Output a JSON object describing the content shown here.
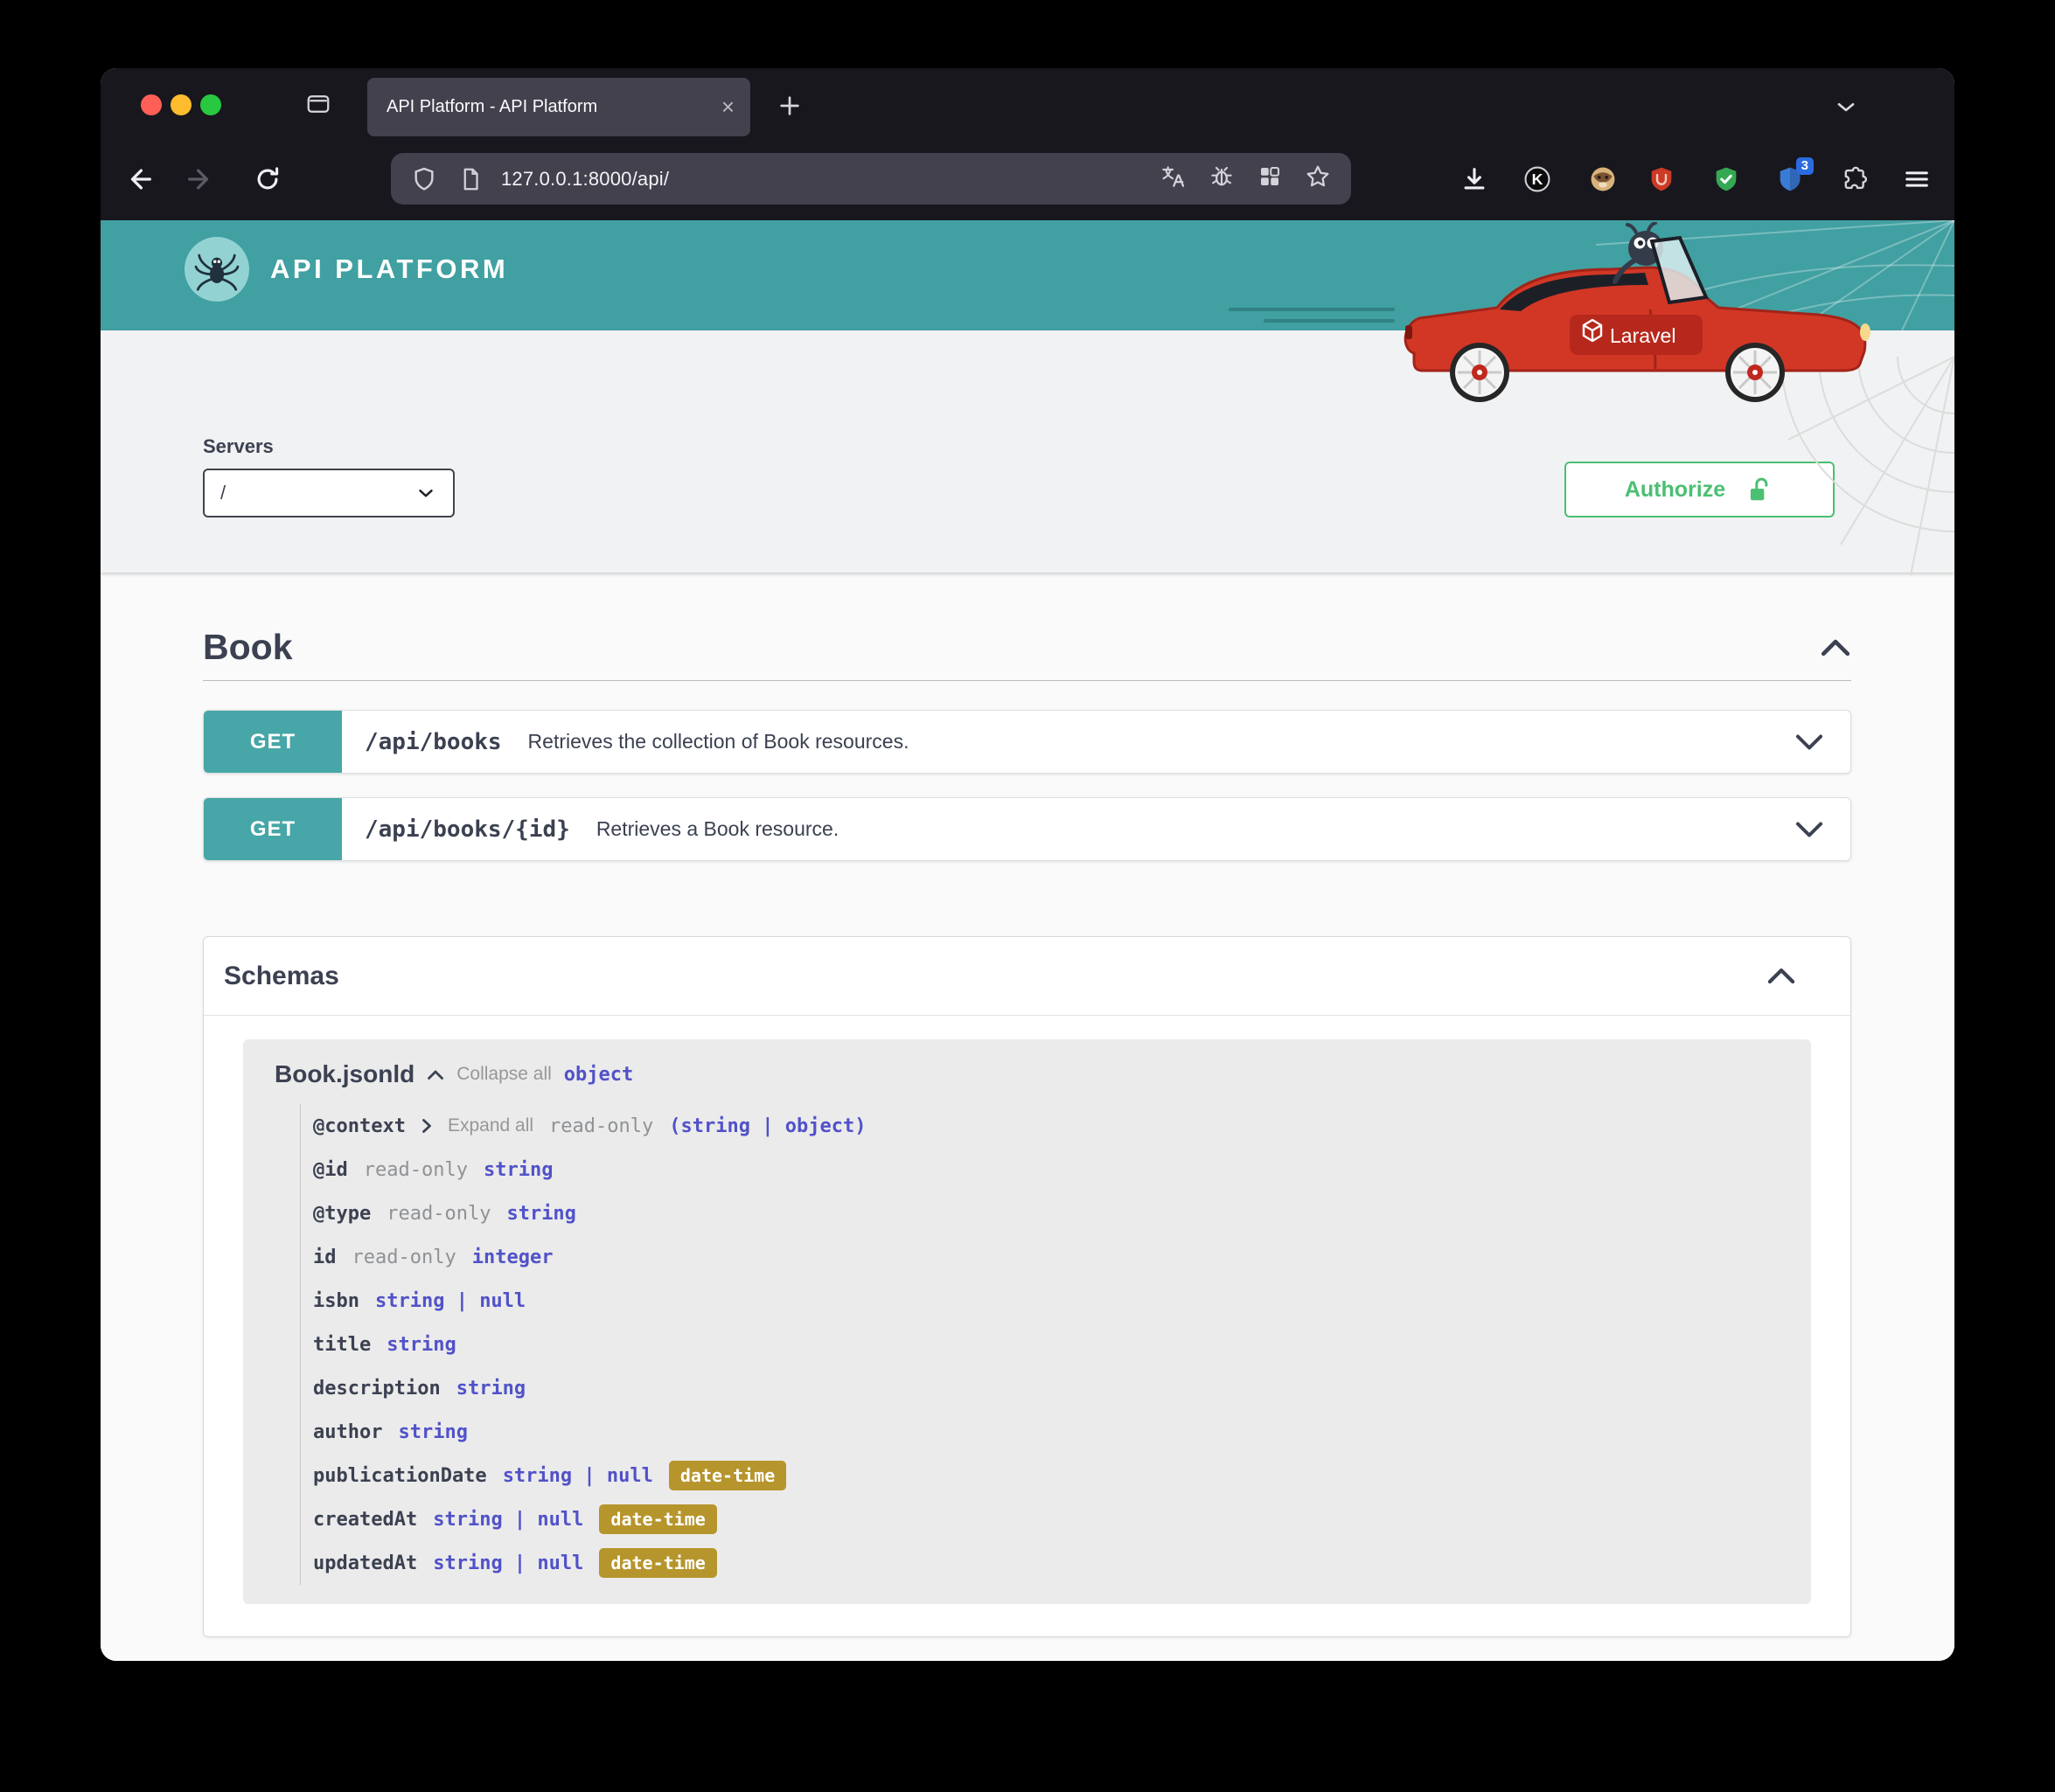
{
  "browser": {
    "tab_title": "API Platform - API Platform",
    "url": "127.0.0.1:8000/api/",
    "extension_badge": "3",
    "k_extension_label": "K"
  },
  "header": {
    "brand": "API PLATFORM",
    "car_badge": "Laravel"
  },
  "servers": {
    "label": "Servers",
    "selected": "/"
  },
  "auth": {
    "authorize_label": "Authorize"
  },
  "tag_section": {
    "title": "Book"
  },
  "operations": [
    {
      "method": "GET",
      "path": "/api/books",
      "description": "Retrieves the collection of Book resources."
    },
    {
      "method": "GET",
      "path": "/api/books/{id}",
      "description": "Retrieves a Book resource."
    }
  ],
  "schemas": {
    "title": "Schemas",
    "model": {
      "name": "Book.jsonld",
      "collapse_all": "Collapse all",
      "expand_all": "Expand all",
      "type": "object",
      "properties": [
        {
          "name": "@context",
          "readonly": "read-only",
          "type": "(string | object)"
        },
        {
          "name": "@id",
          "readonly": "read-only",
          "type": "string"
        },
        {
          "name": "@type",
          "readonly": "read-only",
          "type": "string"
        },
        {
          "name": "id",
          "readonly": "read-only",
          "type": "integer"
        },
        {
          "name": "isbn",
          "type": "string | null"
        },
        {
          "name": "title",
          "type": "string"
        },
        {
          "name": "description",
          "type": "string"
        },
        {
          "name": "author",
          "type": "string"
        },
        {
          "name": "publicationDate",
          "type": "string | null",
          "format": "date-time"
        },
        {
          "name": "createdAt",
          "type": "string | null",
          "format": "date-time"
        },
        {
          "name": "updatedAt",
          "type": "string | null",
          "format": "date-time"
        }
      ]
    }
  },
  "colors": {
    "header_teal": "#41a0a1",
    "get_badge_teal": "#47a6a7",
    "authorize_green": "#4bbf72",
    "type_blue": "#5152c9",
    "format_badge_gold": "#b6952c",
    "text_dark": "#3b4151"
  }
}
